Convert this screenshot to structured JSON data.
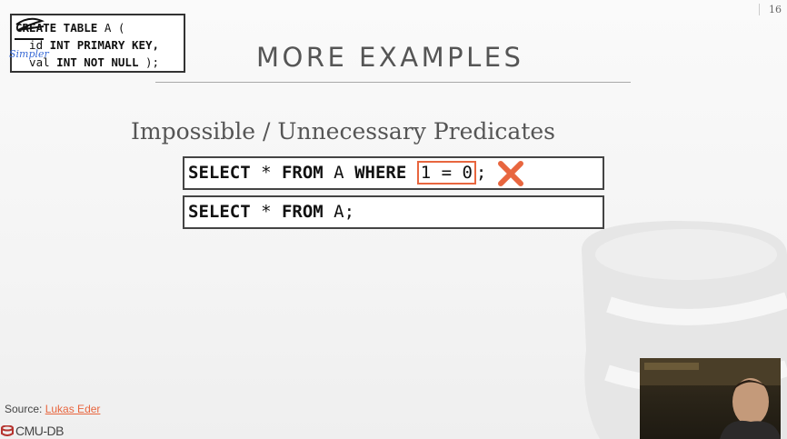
{
  "slide_number": "16",
  "code_box": {
    "line1_kw": "CREATE TABLE",
    "line1_rest": " A (",
    "line2_name": "  id",
    "line2_kw": " INT PRIMARY KEY,",
    "line3_name": "  val",
    "line3_kw": " INT NOT NULL",
    "line3_rest": " );",
    "annotation": "Simpler"
  },
  "title": "MORE EXAMPLES",
  "subtitle": "Impossible / Unnecessary Predicates",
  "sql_examples": [
    {
      "kw1": "SELECT",
      "star": " * ",
      "kw2": "FROM",
      "table": " A ",
      "kw3": "WHERE",
      "space": " ",
      "predicate": "1 = 0",
      "end": ";"
    },
    {
      "kw1": "SELECT",
      "star": " * ",
      "kw2": "FROM",
      "table": " A;"
    }
  ],
  "source": {
    "label": "Source: ",
    "link": "Lukas Eder"
  },
  "logo": "CMU-DB",
  "colors": {
    "accent": "#e8663f",
    "annotation_blue": "#3a6bd6"
  }
}
